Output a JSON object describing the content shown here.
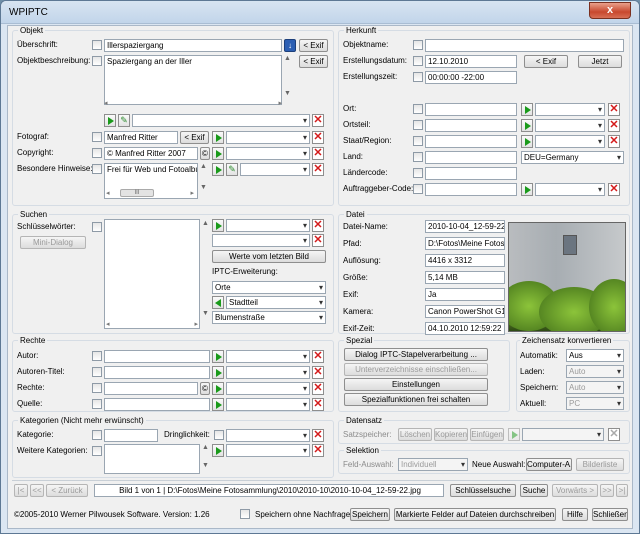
{
  "window": {
    "title": "WPIPTC",
    "close_glyph": "x"
  },
  "objekt": {
    "group_label": "Objekt",
    "ueberschrift_label": "Überschrift:",
    "ueberschrift_value": "Illerspaziergang",
    "exif_label": "< Exif",
    "objektbeschreibung_label": "Objektbeschreibung:",
    "objektbeschreibung_value": "Spaziergang an der Iller",
    "fotograf_label": "Fotograf:",
    "fotograf_value": "Manfred Ritter",
    "copyright_label": "Copyright:",
    "copyright_value": "© Manfred Ritter 2007",
    "copyright_symbol": "©",
    "hinweise_label": "Besondere Hinweise:",
    "hinweise_value": "Frei für Web und Fotoalbu"
  },
  "herkunft": {
    "group_label": "Herkunft",
    "objektname_label": "Objektname:",
    "erstellungsdatum_label": "Erstellungsdatum:",
    "erstellungsdatum_value": "12.10.2010",
    "exif_label": "< Exif",
    "jetzt_label": "Jetzt",
    "erstellungszeit_label": "Erstellungszeit:",
    "erstellungszeit_value": "00:00:00 -22:00",
    "ort_label": "Ort:",
    "ortsteil_label": "Ortsteil:",
    "staat_label": "Staat/Region:",
    "land_label": "Land:",
    "land_value": "DEU=Germany",
    "laendercode_label": "Ländercode:",
    "auftraggeber_label": "Auftraggeber-Code:"
  },
  "suchen": {
    "group_label": "Suchen",
    "schluesselwoerter_label": "Schlüsselwörter:",
    "mini_dialog_label": "Mini-Dialog",
    "werte_label": "Werte vom letzten Bild",
    "iptc_label": "IPTC-Erweiterung:",
    "orte_value": "Orte",
    "stadtteil_value": "Stadtteil",
    "blumenstrasse_value": "Blumenstraße"
  },
  "datei": {
    "group_label": "Datei",
    "name_label": "Datei-Name:",
    "name_value": "2010-10-04_12-59-22.",
    "pfad_label": "Pfad:",
    "pfad_value": "D:\\Fotos\\Meine Fotosa",
    "aufloesung_label": "Auflösung:",
    "aufloesung_value": "4416 x 3312",
    "groesse_label": "Größe:",
    "groesse_value": "5,14 MB",
    "exif_label": "Exif:",
    "exif_value": "Ja",
    "kamera_label": "Kamera:",
    "kamera_value": "Canon PowerShot G10",
    "exifzeit_label": "Exif-Zeit:",
    "exifzeit_value": "04.10.2010 12:59:22"
  },
  "rechte": {
    "group_label": "Rechte",
    "autor_label": "Autor:",
    "autoren_titel_label": "Autoren-Titel:",
    "rechte_label": "Rechte:",
    "rechte_symbol": "©",
    "quelle_label": "Quelle:"
  },
  "spezial": {
    "group_label": "Spezial",
    "stapel_label": "Dialog IPTC-Stapelverarbeitung ...",
    "unterverz_label": "Unterverzeichnisse einschließen...",
    "einstellungen_label": "Einstellungen",
    "spezialfunktionen_label": "Spezialfunktionen frei schalten"
  },
  "zeichensatz": {
    "group_label": "Zeichensatz konvertieren",
    "automatik_label": "Automatik:",
    "automatik_value": "Aus",
    "laden_label": "Laden:",
    "laden_value": "Auto",
    "speichern_label": "Speichern:",
    "speichern_value": "Auto",
    "aktuell_label": "Aktuell:",
    "aktuell_value": "PC"
  },
  "kategorien": {
    "group_label": "Kategorien (Nicht mehr erwünscht)",
    "kategorie_label": "Kategorie:",
    "dringlichkeit_label": "Dringlichkeit:",
    "weitere_label": "Weitere Kategorien:"
  },
  "datensatz": {
    "group_label": "Datensatz",
    "satzspeicher_label": "Satzspeicher:",
    "loeschen_label": "Löschen",
    "kopieren_label": "Kopieren",
    "einfuegen_label": "Einfügen"
  },
  "selektion": {
    "group_label": "Selektion",
    "feld_auswahl_label": "Feld-Auswahl:",
    "feld_auswahl_value": "Individuell",
    "neue_auswahl_label": "Neue Auswahl:",
    "computer_label": "Computer-A.",
    "bilderliste_label": "Bilderliste"
  },
  "nav": {
    "first": "|<",
    "prev_prev": "<<",
    "back_label": "< Zurück",
    "path_text": "Bild 1 von 1  |  D:\\Fotos\\Meine Fotosammlung\\2010\\2010-10\\2010-10-04_12-59-22.jpg",
    "schluesselsuche_label": "Schlüsselsuche",
    "suche_label": "Suche",
    "vorwaerts_label": "Vorwärts >",
    "next_next": ">>",
    "last": ">|"
  },
  "footer": {
    "copyright_text": "©2005-2010 Werner Pilwousek Software. Version: 1.26",
    "speichern_ohne_label": "Speichern ohne Nachfrage",
    "speichern_label": "Speichern",
    "markierte_label": "Markierte Felder auf Dateien durchschreiben",
    "hilfe_label": "Hilfe",
    "schliessen_label": "Schließen"
  },
  "icons": {
    "exif_arrow": "down-arrow-icon",
    "play": "green-play-icon",
    "delete": "red-x-icon",
    "edit": "pencil-icon"
  }
}
